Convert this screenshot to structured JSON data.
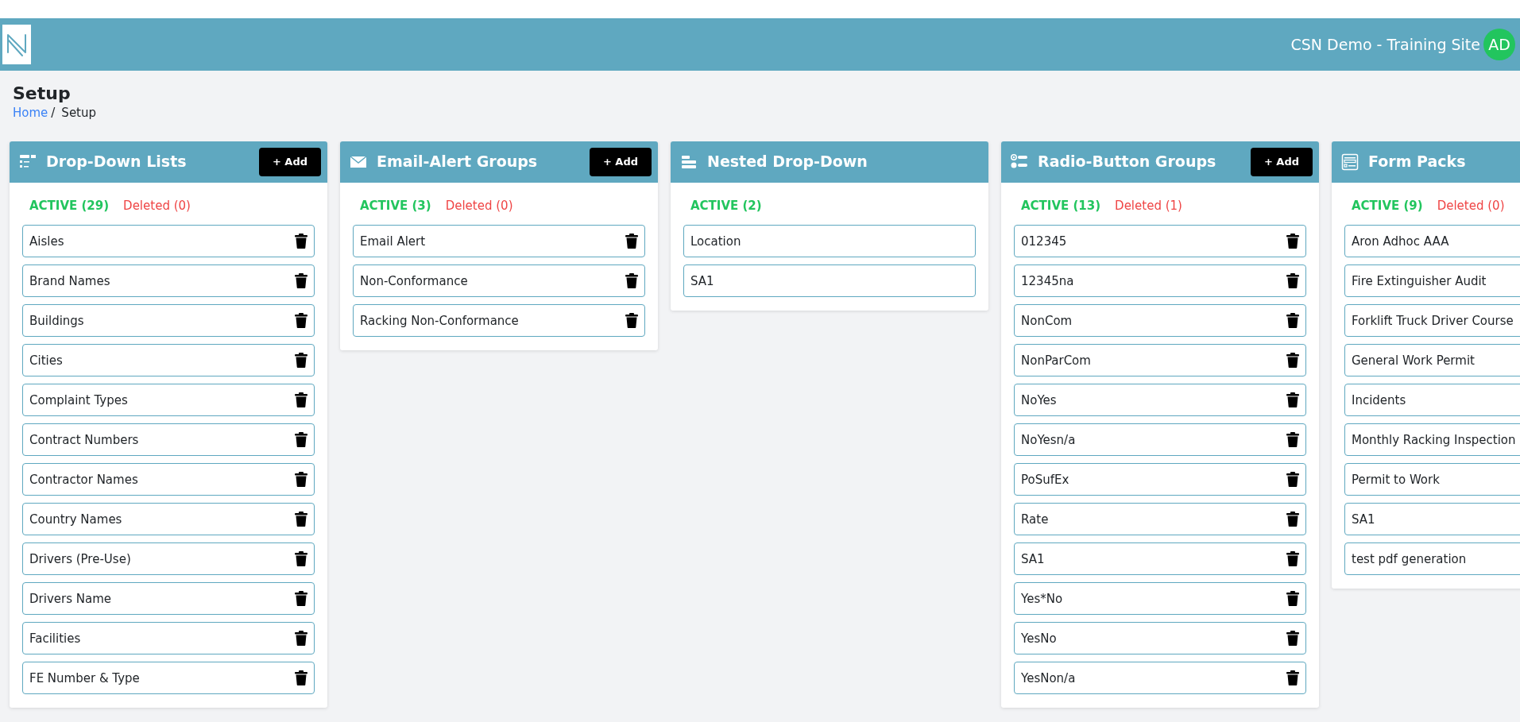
{
  "header": {
    "site_name": "CSN Demo - Training Site",
    "avatar": "AD"
  },
  "page": {
    "title": "Setup",
    "breadcrumb_separator": "/",
    "breadcrumb": [
      {
        "label": "Home",
        "link": true
      },
      {
        "label": "Setup",
        "link": false
      }
    ]
  },
  "cards": [
    {
      "title": "Drop-Down Lists",
      "add_button": "+ Add",
      "deletable": true,
      "tabs": [
        {
          "label": "ACTIVE (29)",
          "selected": true
        },
        {
          "label": "Deleted (0)",
          "selected": false
        }
      ],
      "items": [
        "Aisles",
        "Brand Names",
        "Buildings",
        "Cities",
        "Complaint Types",
        "Contract Numbers",
        "Contractor Names",
        "Country Names",
        "Drivers (Pre-Use)",
        "Drivers Name",
        "Facilities",
        "FE Number & Type"
      ]
    },
    {
      "title": "Email-Alert Groups",
      "add_button": "+ Add",
      "deletable": true,
      "tabs": [
        {
          "label": "ACTIVE (3)",
          "selected": true
        },
        {
          "label": "Deleted (0)",
          "selected": false
        }
      ],
      "items": [
        "Email Alert",
        "Non-Conformance",
        "Racking Non-Conformance"
      ]
    },
    {
      "title": "Nested Drop-Down",
      "deletable": false,
      "tabs": [
        {
          "label": "ACTIVE (2)",
          "selected": true
        }
      ],
      "items": [
        "Location",
        "SA1"
      ]
    },
    {
      "title": "Radio-Button Groups",
      "add_button": "+ Add",
      "deletable": true,
      "tabs": [
        {
          "label": "ACTIVE (13)",
          "selected": true
        },
        {
          "label": "Deleted (1)",
          "selected": false
        }
      ],
      "items": [
        "012345",
        "12345na",
        "NonCom",
        "NonParCom",
        "NoYes",
        "NoYesn/a",
        "PoSufEx",
        "Rate",
        "SA1",
        "Yes*No",
        "YesNo",
        "YesNon/a"
      ]
    },
    {
      "title": "Form Packs",
      "deletable": false,
      "tabs": [
        {
          "label": "ACTIVE (9)",
          "selected": true
        },
        {
          "label": "Deleted (0)",
          "selected": false
        }
      ],
      "items": [
        "Aron Adhoc AAA",
        "Fire Extinguisher Audit",
        "Forklift Truck Driver Course",
        "General Work Permit",
        "Incidents",
        "Monthly Racking Inspection",
        "Permit to Work",
        "SA1",
        "test pdf generation"
      ]
    }
  ]
}
